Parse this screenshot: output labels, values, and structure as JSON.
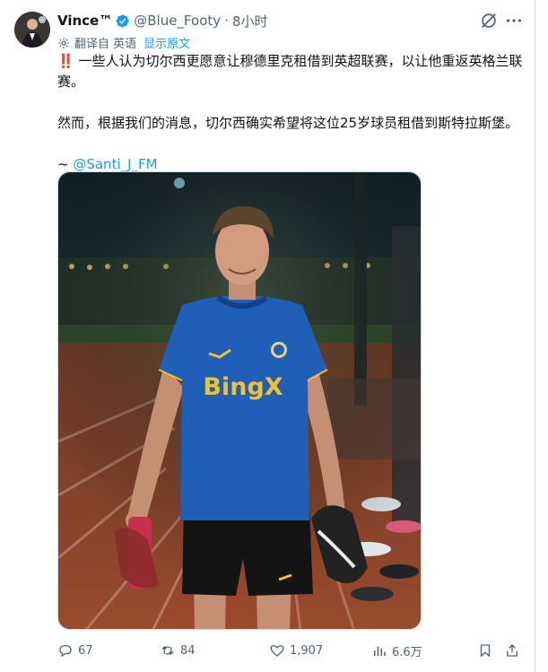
{
  "author": {
    "name": "Vince™",
    "handle": "@Blue_Footy",
    "separator": "·",
    "time": "8小时"
  },
  "translation": {
    "label": "翻译自 英语",
    "show_original": "显示原文"
  },
  "tweet": {
    "line1_mark": "‼️",
    "line1": "一些人认为切尔西更愿意让穆德里克租借到英超联赛，以让他重返英格兰联赛。",
    "line2": "然而，根据我们的消息，切尔西确实希望将这位25岁球员租借到斯特拉斯堡。",
    "credit_prefix": "~ ",
    "credit_mention": "@Santi_J_FM"
  },
  "media": {
    "jersey_text": "BingX"
  },
  "actions": {
    "replies": "67",
    "reposts": "84",
    "likes": "1,907",
    "views": "6.6万"
  },
  "colors": {
    "accent": "#1d9bf0",
    "muted": "#536471",
    "text": "#0f1419",
    "jersey": "#1f5fb8"
  },
  "icons": [
    "verified-badge-icon",
    "grok-icon",
    "more-icon",
    "translate-gear-icon",
    "reply-icon",
    "repost-icon",
    "like-icon",
    "views-icon",
    "bookmark-icon",
    "share-icon"
  ]
}
